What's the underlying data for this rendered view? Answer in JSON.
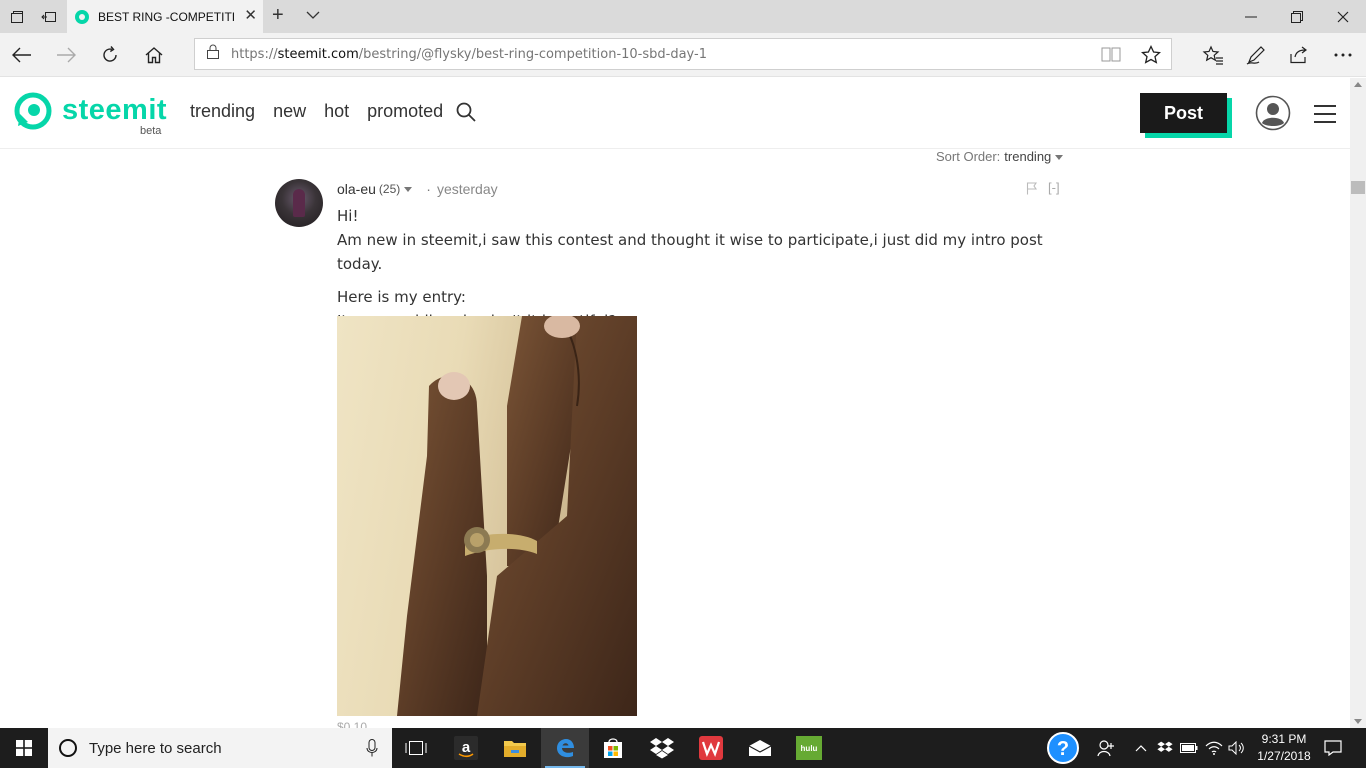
{
  "browser": {
    "tab_title": "BEST RING -COMPETITI",
    "url_prefix": "https://",
    "url_host": "steemit.com",
    "url_path": "/bestring/@flysky/best-ring-competition-10-sbd-day-1"
  },
  "site": {
    "brand": "steemit",
    "beta": "beta",
    "nav": [
      "trending",
      "new",
      "hot",
      "promoted"
    ],
    "post_button": "Post",
    "accent_color": "#06d6a9"
  },
  "comments": {
    "sort_label": "Sort Order:",
    "sort_value": "trending",
    "comment": {
      "author": "ola-eu",
      "reputation": "(25)",
      "time": "yesterday",
      "collapse": "[-]",
      "paragraphs": [
        "Hi!\nAm new in steemit,i saw this contest and thought it wise to participate,i just did my intro post today.",
        "Here is my entry:\nIts my wedding ring,isn't it beautiful?"
      ],
      "footer_partial": "$0.10"
    }
  },
  "taskbar": {
    "search_placeholder": "Type here to search",
    "time": "9:31 PM",
    "date": "1/27/2018"
  }
}
